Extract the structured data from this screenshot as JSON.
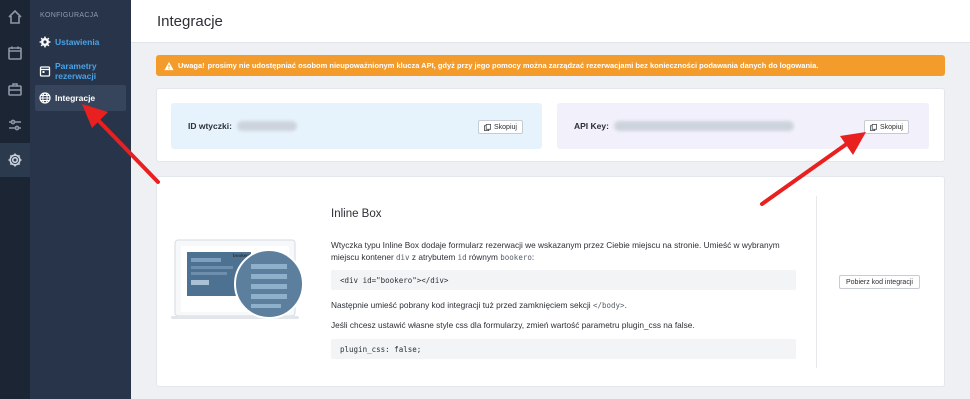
{
  "rail": {
    "items": [
      {
        "name": "home-icon"
      },
      {
        "name": "calendar-icon"
      },
      {
        "name": "briefcase-icon"
      },
      {
        "name": "sliders-icon"
      },
      {
        "name": "gear-icon"
      }
    ]
  },
  "sidebar": {
    "section_title": "KONFIGURACJA",
    "items": [
      {
        "label": "Ustawienia",
        "icon": "gear-icon"
      },
      {
        "label": "Parametry rezerwacji",
        "icon": "calendar-icon"
      },
      {
        "label": "Integracje",
        "icon": "globe-icon"
      }
    ]
  },
  "header": {
    "title": "Integracje"
  },
  "alert": {
    "strong": "Uwaga!",
    "text": "prosimy nie udostępniać osobom nieupoważnionym klucza API, gdyż przy jego pomocy można zarządzać rezerwacjami bez konieczności podawania danych do logowania."
  },
  "keys": {
    "widget_id_label": "ID wtyczki:",
    "api_key_label": "API Key:",
    "copy_label": "Skopiuj"
  },
  "inline_box": {
    "title": "Inline Box",
    "desc_1": "Wtyczka typu Inline Box dodaje formularz rezerwacji we wskazanym przez Ciebie miejscu na stronie. Umieść w wybranym",
    "desc_2a": "miejscu kontener",
    "desc_2_div": "div",
    "desc_2b": "z atrybutem",
    "desc_2_id": "id",
    "desc_2c": "równym",
    "desc_2_val": "bookero",
    "desc_2d": ":",
    "code_1": "<div id=\"bookero\"></div>",
    "desc_3a": "Następnie umieść pobrany kod integracji tuż przed zamknięciem sekcji",
    "desc_3_tag": "</body>",
    "desc_3b": ".",
    "desc_4": "Jeśli chcesz ustawić własne style css dla formularzy, zmień wartość parametru plugin_css na false.",
    "code_2": "plugin_css: false;",
    "get_code_button": "Pobierz kod integracji",
    "preview_brand": "bookero"
  },
  "colors": {
    "rail_bg": "#1c2534",
    "sidebar_bg": "#27344a",
    "accent": "#4aa3e6",
    "alert_bg": "#f39c2c",
    "arrow": "#e8201f"
  }
}
